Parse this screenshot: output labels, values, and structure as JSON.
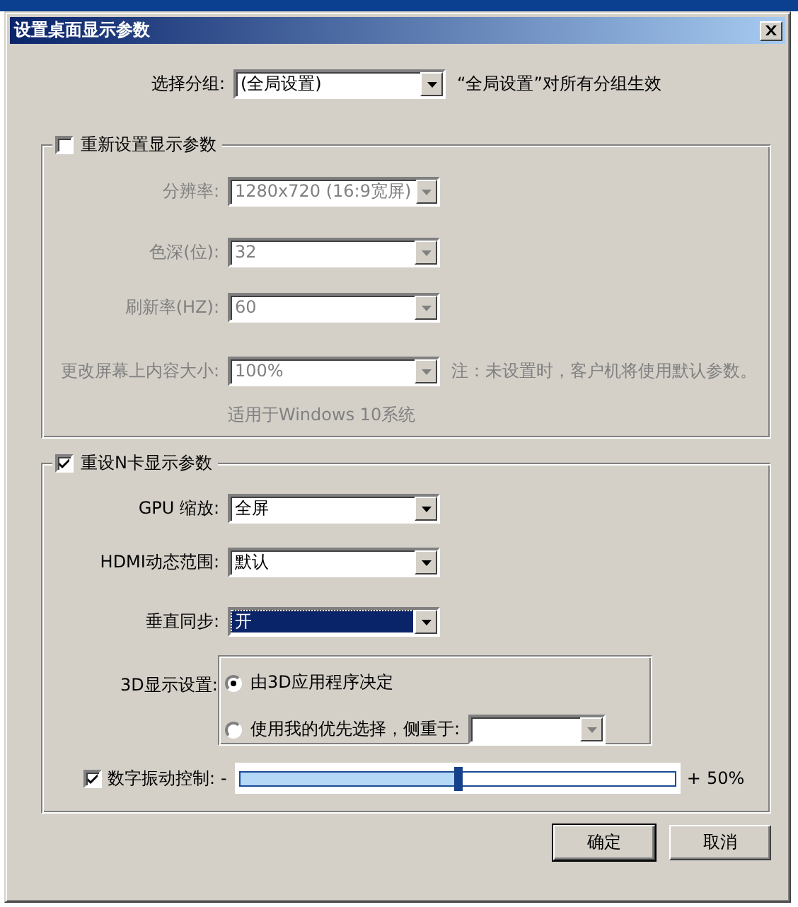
{
  "window": {
    "title": "设置桌面显示参数"
  },
  "group_select": {
    "label": "选择分组:",
    "value": "(全局设置)",
    "note": "“全局设置”对所有分组生效"
  },
  "display_section": {
    "label": "重新设置显示参数",
    "checked": false,
    "fields": [
      {
        "label": "分辨率:",
        "value": "1280x720 (16:9宽屏)"
      },
      {
        "label": "色深(位):",
        "value": "32"
      },
      {
        "label": "刷新率(HZ):",
        "value": "60"
      },
      {
        "label": "更改屏幕上内容大小:",
        "value": "100%",
        "note": "注：未设置时，客户机将使用默认参数。"
      }
    ],
    "os_note": "适用于Windows 10系统"
  },
  "nvidia_section": {
    "label": "重设N卡显示参数",
    "checked": true,
    "fields": [
      {
        "label": "GPU 缩放:",
        "value": "全屏",
        "focused": false
      },
      {
        "label": "HDMI动态范围:",
        "value": "默认",
        "focused": false
      },
      {
        "label": "垂直同步:",
        "value": "开",
        "focused": true
      }
    ],
    "mode_3d": {
      "label": "3D显示设置:",
      "options": [
        {
          "kind": "radio",
          "label": "由3D应用程序决定",
          "selected": true
        },
        {
          "kind": "radio-select",
          "label": "使用我的优先选择，侧重于:",
          "selected": false
        }
      ]
    },
    "vibrance": {
      "label": "数字振动控制:",
      "checked": true,
      "minus": "-",
      "plus": "+",
      "reading": "50%",
      "level": 0.5
    }
  },
  "buttons": [
    {
      "label": "确定",
      "default": true
    },
    {
      "label": "取消",
      "default": false
    }
  ]
}
